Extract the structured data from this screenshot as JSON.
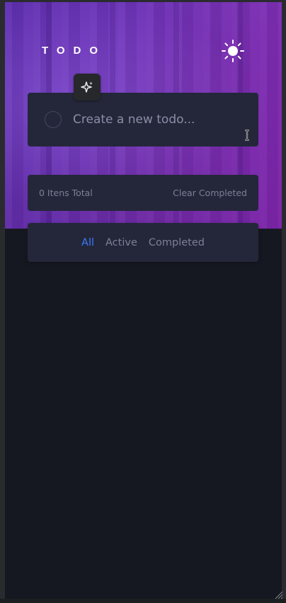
{
  "app": {
    "title": "TODO"
  },
  "theme_toggle": {
    "icon": "sun-icon"
  },
  "sparkle_button": {
    "icon": "sparkle-icon"
  },
  "new_todo": {
    "placeholder": "Create a new todo...",
    "value": ""
  },
  "footer": {
    "items_total": "0 Itens Total",
    "clear_completed": "Clear Completed"
  },
  "filters": {
    "all": "All",
    "active": "Active",
    "completed": "Completed",
    "selected": "All"
  },
  "colors": {
    "accent": "#3a7bfd",
    "card": "#24273a",
    "background": "#161821",
    "hero_start": "#5e2fb0",
    "hero_end": "#8a2ab8"
  }
}
